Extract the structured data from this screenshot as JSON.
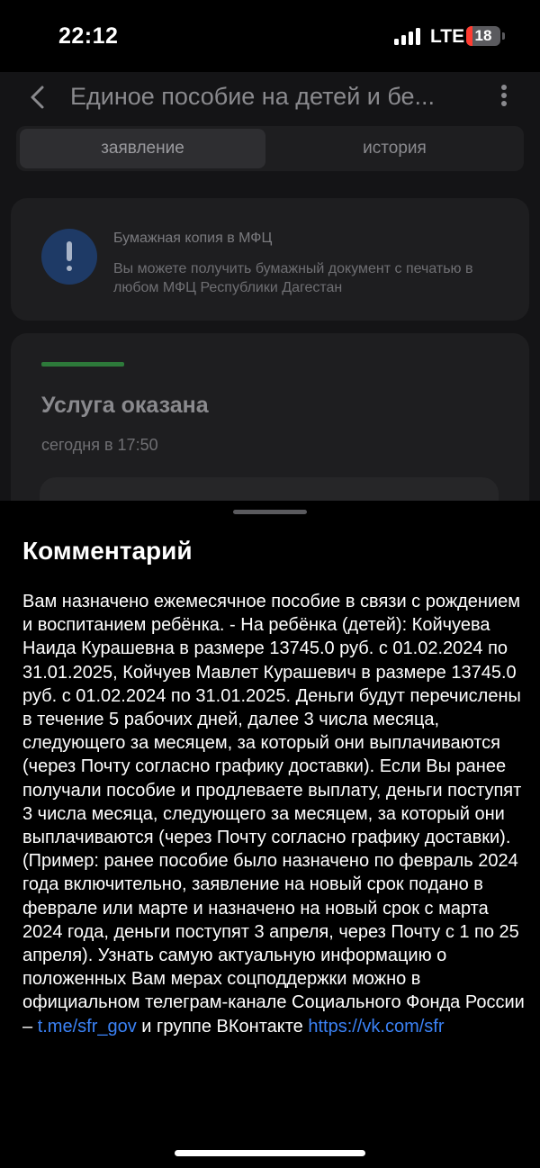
{
  "status_bar": {
    "time": "22:12",
    "network": "LTE",
    "battery": "18",
    "battery_level": 0.18
  },
  "nav": {
    "title": "Единое пособие на детей и бе..."
  },
  "tabs": [
    {
      "label": "заявление",
      "active": true
    },
    {
      "label": "история",
      "active": false
    }
  ],
  "info_card": {
    "title": "Бумажная копия в МФЦ",
    "text": "Вы можете получить бумажный документ с печатью в любом МФЦ Республики Дагестан"
  },
  "status_card": {
    "title": "Услуга оказана",
    "time": "сегодня в 17:50",
    "accent": "#2d7a3a"
  },
  "sheet": {
    "title": "Комментарий",
    "comment_text": "Вам назначено ежемесячное пособие в связи с рождением и воспитанием ребёнка. - На ребёнка (детей): Койчуева Наида Курашевна в размере 13745.0 руб. с 01.02.2024 по 31.01.2025, Койчуев Мавлет Курашевич в размере 13745.0 руб. с 01.02.2024 по 31.01.2025. Деньги будут перечислены в течение 5 рабочих дней, далее 3 числа месяца, следующего за месяцем, за который они выплачиваются (через Почту согласно графику доставки). Если Вы ранее получали пособие и продлеваете выплату, деньги поступят 3 числа месяца, следующего за месяцем, за который они выплачиваются (через Почту согласно графику доставки). (Пример: ранее пособие было назначено по февраль 2024 года включительно, заявление на новый срок подано в феврале или марте и назначено на новый срок с марта 2024 года, деньги поступят 3 апреля, через Почту с 1 по 25 апреля). Узнать самую актуальную информацию о положенных Вам мерах соцподдержки можно в официальном телеграм-канале Социального Фонда России – ",
    "link_telegram": "t.me/sfr_gov",
    "text_between": " и группе ВКонтакте ",
    "link_vk": "https://vk.com/sfr",
    "link_color": "#3b82f6"
  }
}
